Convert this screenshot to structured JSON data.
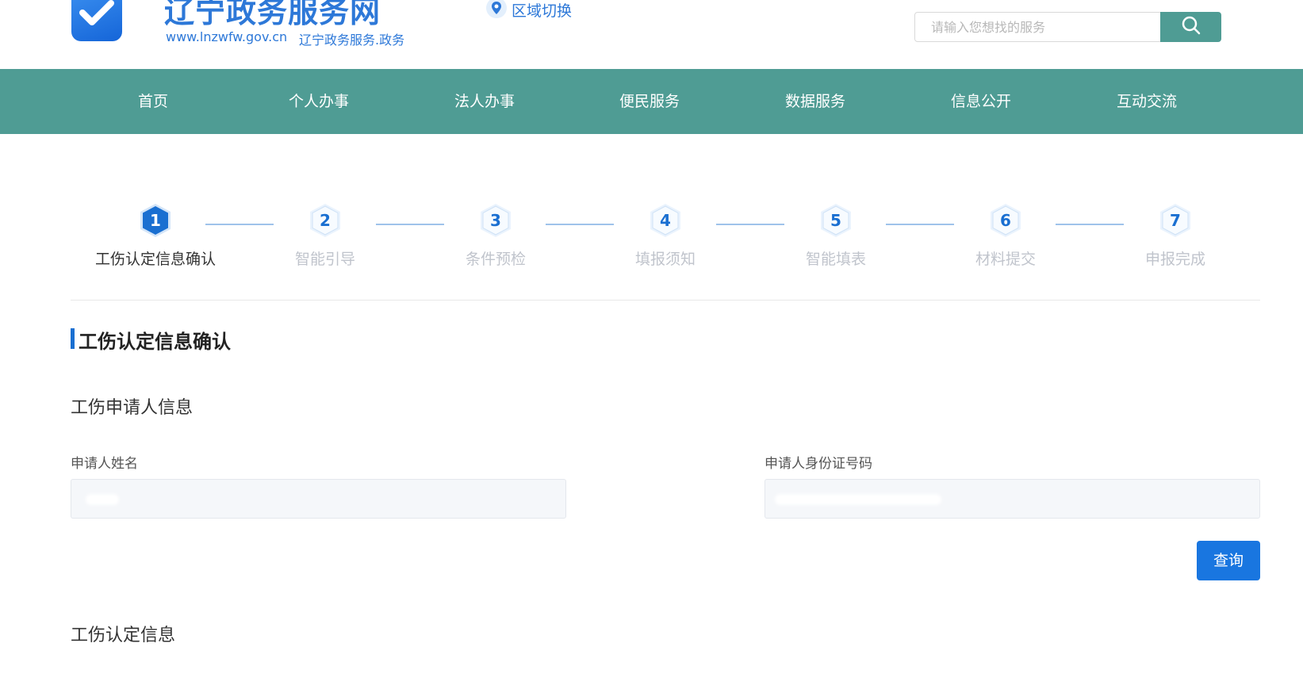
{
  "header": {
    "site_title": "辽宁政务服务网",
    "site_url": "www.lnzwfw.gov.cn",
    "site_sub": "辽宁政务服务.政务",
    "region_label": "区域切换",
    "search_placeholder": "请输入您想找的服务"
  },
  "nav": {
    "items": [
      "首页",
      "个人办事",
      "法人办事",
      "便民服务",
      "数据服务",
      "信息公开",
      "互动交流"
    ]
  },
  "steps": [
    {
      "num": "1",
      "label": "工伤认定信息确认",
      "active": true
    },
    {
      "num": "2",
      "label": "智能引导",
      "active": false
    },
    {
      "num": "3",
      "label": "条件预检",
      "active": false
    },
    {
      "num": "4",
      "label": "填报须知",
      "active": false
    },
    {
      "num": "5",
      "label": "智能填表",
      "active": false
    },
    {
      "num": "6",
      "label": "材料提交",
      "active": false
    },
    {
      "num": "7",
      "label": "申报完成",
      "active": false
    }
  ],
  "section": {
    "title": "工伤认定信息确认",
    "applicant_heading": "工伤申请人信息",
    "name_label": "申请人姓名",
    "id_label": "申请人身份证号码",
    "query_label": "查询",
    "identification_heading": "工伤认定信息"
  },
  "colors": {
    "nav_bg": "#4f9c94",
    "brand_blue": "#1a6fd1",
    "step_line": "#9fc3ea"
  }
}
